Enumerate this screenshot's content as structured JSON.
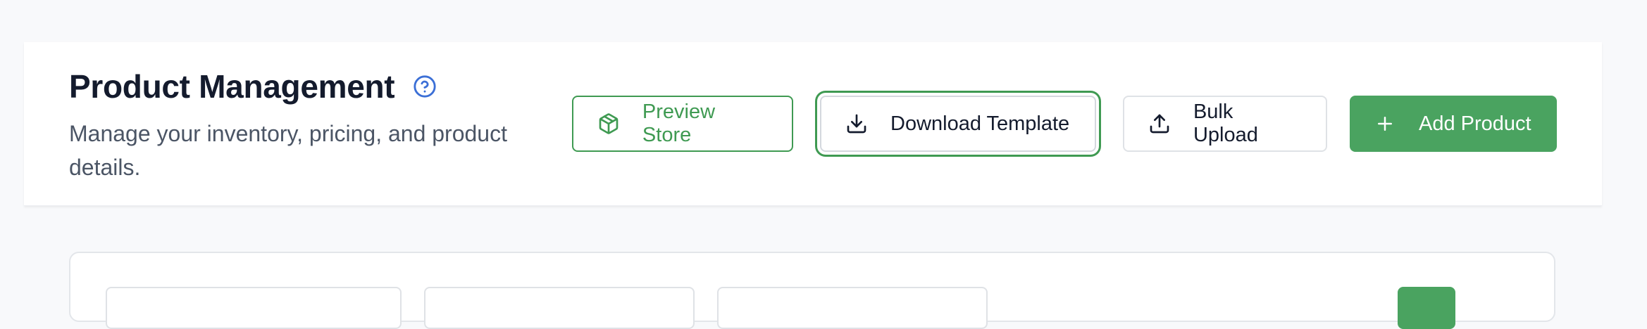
{
  "header": {
    "title": "Product Management",
    "subtitle": "Manage your inventory, pricing, and product details."
  },
  "actions": {
    "preview_label": "Preview Store",
    "download_label": "Download Template",
    "bulk_label": "Bulk Upload",
    "add_label": "Add Product"
  },
  "icons": {
    "help": "help-circle-icon",
    "preview": "package-icon",
    "download": "download-icon",
    "bulk": "upload-icon",
    "add": "plus-icon"
  },
  "colors": {
    "accent": "#4aa360",
    "accent_text": "#3f9a52",
    "help_icon": "#3b6fd6",
    "title": "#141b2d",
    "subtitle": "#4b5565"
  }
}
